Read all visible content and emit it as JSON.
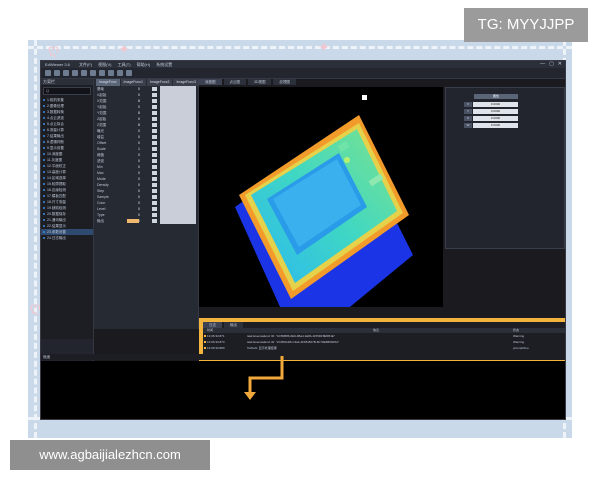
{
  "watermark_top": "TG: MYYJJPP",
  "watermark_bottom": "www.agbaijialezhcn.com",
  "app": {
    "title": "EdWiewer 3.6",
    "menus": [
      "文件(F)",
      "视图(V)",
      "工具(T)",
      "帮助(H)",
      "系统设置"
    ],
    "window_controls": [
      "—",
      "▢",
      "✕"
    ],
    "tree": {
      "header": "方案栏",
      "search_placeholder": "Q",
      "items": [
        "1.相机采集",
        "2.图像处理",
        "3.数据转换",
        "4.点云滤波",
        "5.点云拟合",
        "6.测量计算",
        "7.结果输出",
        "8.逻辑判断",
        "9.显示设置",
        "10.深度图",
        "11.灰度图",
        "12.平面校正",
        "13.高度计算",
        "14.区域选择",
        "15.轮廓提取",
        "16.边缘检测",
        "17.模板匹配",
        "18.尺寸测量",
        "19.缺陷检测",
        "20.数据保存",
        "21.通讯输出",
        "22.结果显示",
        "23.参数设置",
        "24.日志输出"
      ],
      "selected_index": 22
    },
    "param_tabs": [
      "ImageFunc",
      "ImageFunc1",
      "ImageFunc2",
      "ImageFunc3"
    ],
    "params": [
      {
        "label": "基础",
        "value": "0"
      },
      {
        "label": "X起始",
        "value": "0"
      },
      {
        "label": "X范围",
        "value": "8"
      },
      {
        "label": "Y起始",
        "value": "0"
      },
      {
        "label": "Y范围",
        "value": "8"
      },
      {
        "label": "Z起始",
        "value": "0"
      },
      {
        "label": "Z范围",
        "value": "8"
      },
      {
        "label": "曝光",
        "value": "0"
      },
      {
        "label": "增益",
        "value": "0"
      },
      {
        "label": "Offset",
        "value": "0"
      },
      {
        "label": "Scale",
        "value": "1"
      },
      {
        "label": "阈值",
        "value": "0"
      },
      {
        "label": "滤波",
        "value": "0"
      },
      {
        "label": "Min",
        "value": "0"
      },
      {
        "label": "Max",
        "value": "0"
      },
      {
        "label": "Mode",
        "value": "0"
      },
      {
        "label": "Density",
        "value": "0"
      },
      {
        "label": "Step",
        "value": "0"
      },
      {
        "label": "Sample",
        "value": "0"
      },
      {
        "label": "Color",
        "value": "0"
      },
      {
        "label": "Level",
        "value": "0"
      },
      {
        "label": "Type",
        "value": "0"
      },
      {
        "label": "输出",
        "value": "0"
      }
    ],
    "view_tabs": [
      "深度图",
      "点云图",
      "3D视图",
      "纹理图"
    ],
    "right_panel": {
      "title": "属性",
      "rows": [
        {
          "k": "X",
          "v": "0.0000"
        },
        {
          "k": "Y",
          "v": "0.0000"
        },
        {
          "k": "Z",
          "v": "0.0000"
        },
        {
          "k": "W",
          "v": "0.0000"
        }
      ]
    },
    "log": {
      "tabs": [
        "日志",
        "输出"
      ],
      "columns": [
        "时间",
        "信息",
        "状态"
      ],
      "rows": [
        {
          "time": "13:06:33.871",
          "msg": "task ExecuteEnd: ID: \"4C56B86-0E9-4Ba4-9a8b-1155DF8E5B1E\"",
          "status": "Warning"
        },
        {
          "time": "13:06:33.873",
          "msg": "task ExecuteEnd: ID: \"2C056A1B-C3ab-4F85-B07B-6F70E6B09F6A\"",
          "status": "Warning"
        },
        {
          "time": "13:06:33.880",
          "msg": "ToWork: 显示处理结果",
          "status": "prompt/time"
        }
      ]
    },
    "status_text": "就绪"
  }
}
